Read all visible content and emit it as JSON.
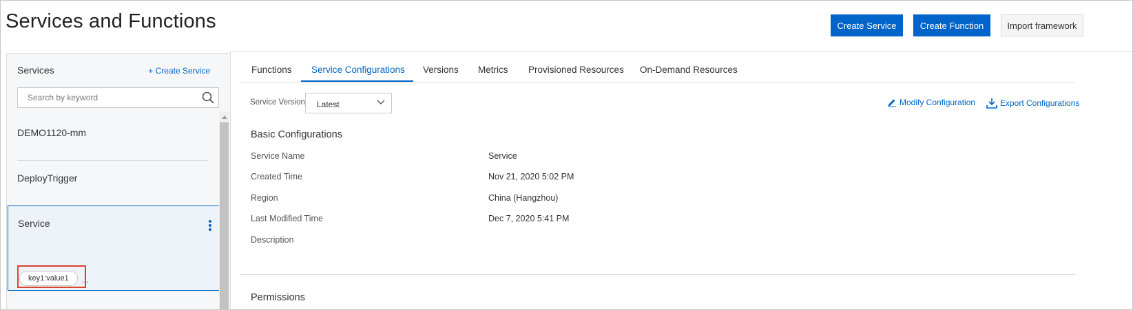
{
  "page": {
    "title": "Services and Functions"
  },
  "header_buttons": {
    "create_service": "Create Service",
    "create_function": "Create Function",
    "import_framework": "Import framework"
  },
  "sidebar": {
    "title": "Services",
    "create_link": "+ Create Service",
    "search_placeholder": "Search by keyword",
    "items": [
      {
        "name": "DEMO1120-mm"
      },
      {
        "name": "DeployTrigger"
      },
      {
        "name": "Service",
        "selected": true,
        "tag": "key1:value1",
        "more": "..."
      }
    ]
  },
  "tabs": [
    {
      "label": "Functions",
      "active": false
    },
    {
      "label": "Service Configurations",
      "active": true
    },
    {
      "label": "Versions",
      "active": false
    },
    {
      "label": "Metrics",
      "active": false
    },
    {
      "label": "Provisioned Resources",
      "active": false
    },
    {
      "label": "On-Demand Resources",
      "active": false
    }
  ],
  "toolbar": {
    "version_label": "Service Version:",
    "version_value": "Latest",
    "modify_label": "Modify Configuration",
    "export_label": "Export Configurations"
  },
  "basic": {
    "title": "Basic Configurations",
    "rows": [
      {
        "label": "Service Name",
        "value": "Service"
      },
      {
        "label": "Created Time",
        "value": "Nov 21, 2020 5:02 PM"
      },
      {
        "label": "Region",
        "value": "China (Hangzhou)"
      },
      {
        "label": "Last Modified Time",
        "value": "Dec 7, 2020 5:41 PM"
      },
      {
        "label": "Description",
        "value": ""
      }
    ]
  },
  "next_section": {
    "title": "Permissions"
  },
  "colors": {
    "primary": "#0064c8",
    "highlight": "#d9432f"
  }
}
